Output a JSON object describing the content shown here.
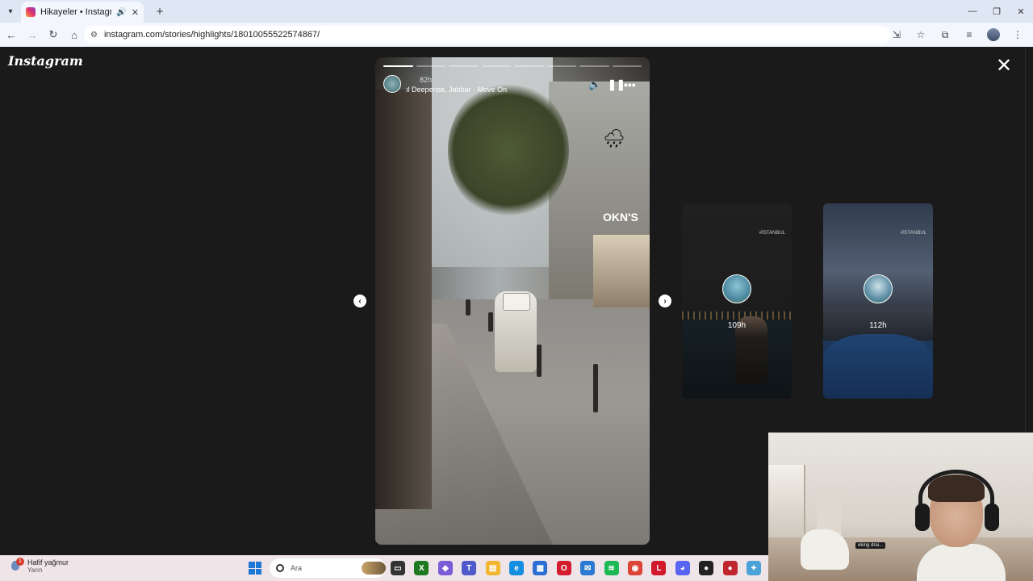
{
  "browser": {
    "tab_title": "Hikayeler • Instagram",
    "new_tab": "+",
    "url": "instagram.com/stories/highlights/18010055522574867/",
    "controls": {
      "minimize": "—",
      "restore": "❐",
      "close": "✕"
    },
    "nav": {
      "back": "←",
      "forward": "→",
      "reload": "↻",
      "home": "⌂"
    }
  },
  "instagram": {
    "logo_text": "Instagram",
    "close_symbol": "✕",
    "story": {
      "time": "82h",
      "audio": "Deeperise, Jabbar · Move On",
      "sign_text": "OKN'S",
      "weather_glyph": "🌧",
      "plate_text": "34 KF 299",
      "progress_segments": 8,
      "progress_done": 1
    },
    "prev_arrow": "‹",
    "next_arrow": "›",
    "previews": [
      {
        "label": "109h",
        "tag": "#İSTANBUL"
      },
      {
        "label": "112h",
        "tag": "#İSTANBUL"
      }
    ]
  },
  "webcam": {
    "mic_label": "eking drai..."
  },
  "taskbar": {
    "weather_title": "Hafif yağmur",
    "weather_sub": "Yarın",
    "weather_badge": "1",
    "search_placeholder": "Ara",
    "apps": [
      {
        "name": "task-view",
        "color": "#333333",
        "glyph": "▭"
      },
      {
        "name": "xbox",
        "color": "#1e7a22",
        "glyph": "X"
      },
      {
        "name": "copilot",
        "color": "#7b5cd6",
        "glyph": "◆"
      },
      {
        "name": "teams",
        "color": "#5059c9",
        "glyph": "T"
      },
      {
        "name": "file-explorer",
        "color": "#f2b632",
        "glyph": "▤"
      },
      {
        "name": "edge",
        "color": "#138ee0",
        "glyph": "e"
      },
      {
        "name": "store",
        "color": "#2a6fd1",
        "glyph": "▦"
      },
      {
        "name": "opera",
        "color": "#d31d2e",
        "glyph": "O"
      },
      {
        "name": "mail",
        "color": "#2a7ad4",
        "glyph": "✉"
      },
      {
        "name": "spotify",
        "color": "#1db954",
        "glyph": "≋"
      },
      {
        "name": "chrome",
        "color": "#dc4437",
        "glyph": "◉"
      },
      {
        "name": "app-l",
        "color": "#d1192b",
        "glyph": "L"
      },
      {
        "name": "discord",
        "color": "#5865f2",
        "glyph": "◕"
      },
      {
        "name": "app-pin",
        "color": "#222222",
        "glyph": "●"
      },
      {
        "name": "app-red",
        "color": "#c0262d",
        "glyph": "●"
      },
      {
        "name": "app-extra",
        "color": "#4aa3d8",
        "glyph": "✦"
      }
    ]
  }
}
